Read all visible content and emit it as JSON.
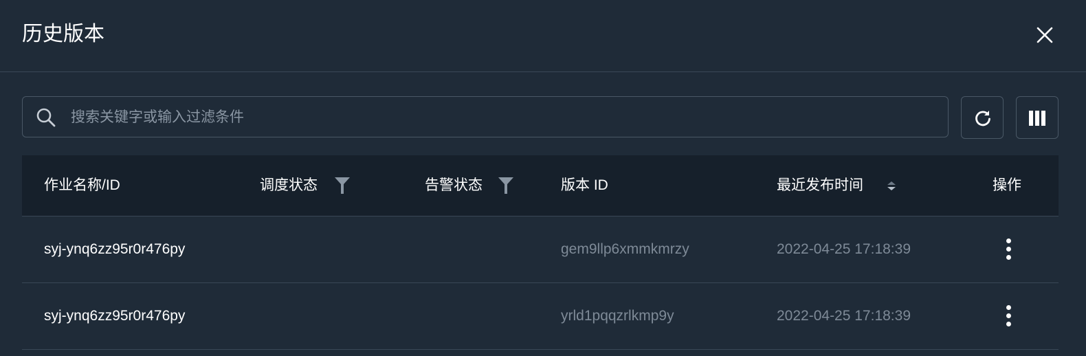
{
  "dialog": {
    "title": "历史版本",
    "close_icon": "close-icon"
  },
  "search": {
    "placeholder": "搜索关键字或输入过滤条件",
    "value": "",
    "icon": "search-icon"
  },
  "toolbar": {
    "refresh_icon": "refresh-icon",
    "columns_icon": "columns-icon"
  },
  "table": {
    "headers": {
      "name": "作业名称/ID",
      "schedule_status": "调度状态",
      "alarm_status": "告警状态",
      "version_id": "版本 ID",
      "publish_time": "最近发布时间",
      "actions": "操作"
    },
    "rows": [
      {
        "name": "syj-ynq6zz95r0r476py",
        "schedule_status": "",
        "alarm_status": "",
        "version_id": "gem9llp6xmmkmrzy",
        "publish_time": "2022-04-25 17:18:39"
      },
      {
        "name": "syj-ynq6zz95r0r476py",
        "schedule_status": "",
        "alarm_status": "",
        "version_id": "yrld1pqqzrlkmp9y",
        "publish_time": "2022-04-25 17:18:39"
      }
    ]
  },
  "colors": {
    "background": "#1f2b38",
    "header_background": "#16202b",
    "border": "#3a4857",
    "text": "#ffffff",
    "muted_text": "#7e8a97"
  }
}
